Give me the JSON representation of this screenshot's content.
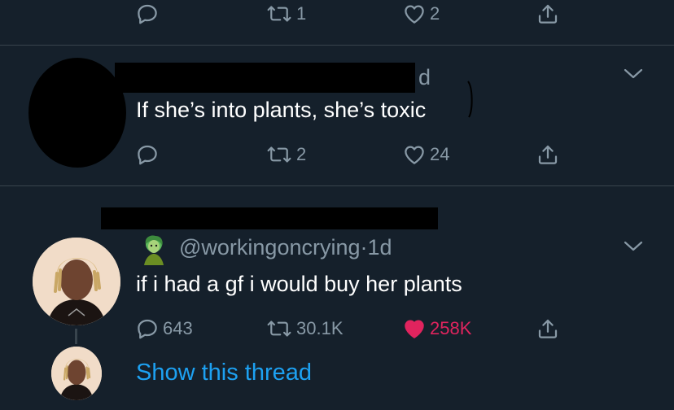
{
  "tweet1": {
    "reply_count": "",
    "retweet_count": "1",
    "like_count": "2"
  },
  "tweet2": {
    "timestamp": "d",
    "text": "If she’s into plants, she’s toxic",
    "reply_count": "",
    "retweet_count": "2",
    "like_count": "24"
  },
  "tweet3": {
    "handle": "@workingoncrying",
    "separator": "·",
    "timestamp": "1d",
    "text": "if i had a gf i would buy her plants",
    "reply_count": "643",
    "retweet_count": "30.1K",
    "like_count": "258K"
  },
  "thread": {
    "show_label": "Show this thread"
  },
  "colors": {
    "background": "#15202b",
    "muted": "#8899a6",
    "link": "#1da1f2",
    "like_active": "#e0245e"
  }
}
